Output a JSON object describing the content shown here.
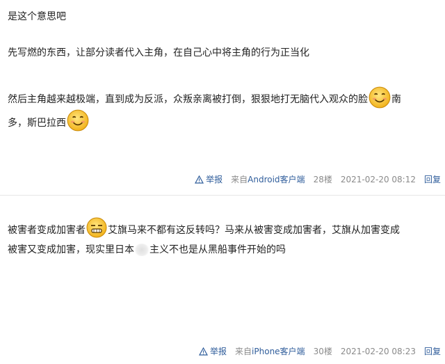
{
  "post1": {
    "line1": "是这个意思吧",
    "line2": "先写燃的东西，让部分读者代入主角，在自己心中将主角的行为正当化",
    "line3a": "然后主角越来越极端，直到成为反派，众叛亲离被打倒，狠狠地打无脑代入观众的脸",
    "line3b": "南",
    "line4a": "多，斯巴拉西",
    "meta": {
      "report": "举报",
      "from_prefix": "来自",
      "client": "Android客户端",
      "floor": "28楼",
      "time": "2021-02-20 08:12",
      "reply": "回复"
    }
  },
  "post2": {
    "line1a": "被害者变成加害者",
    "line1b": "艾旗马来不都有这反转吗？马来从被害变成加害者，艾旗从加害变成",
    "line2a": "被害又变成加害，现实里日本",
    "line2b": "主义不也是从黑船事件开始的吗",
    "meta": {
      "report": "举报",
      "from_prefix": "来自",
      "client": "iPhone客户端",
      "floor": "30楼",
      "time": "2021-02-20 08:23",
      "reply": "回复"
    }
  },
  "colors": {
    "link": "#2f5d9b",
    "meta_text": "#8a8a8a",
    "divider": "#e6e6e6"
  },
  "icons": [
    "smiley-emoji-icon",
    "smirk-emoji-icon",
    "report-warning-icon"
  ]
}
